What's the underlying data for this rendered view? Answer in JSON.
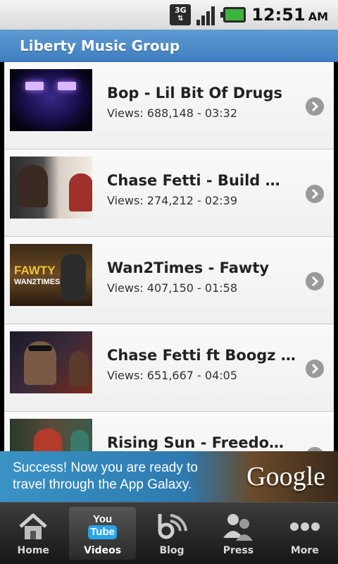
{
  "status_bar": {
    "network_label": "3G",
    "time": "12:51",
    "ampm": "AM"
  },
  "header": {
    "title": "Liberty Music Group"
  },
  "videos": [
    {
      "title": "Bop - Lil Bit Of Drugs",
      "meta": "Views: 688,148 - 03:32"
    },
    {
      "title": "Chase Fetti - Build Wi...",
      "meta": "Views: 274,212 - 02:39"
    },
    {
      "title": "Wan2Times - Fawty",
      "meta": "Views: 407,150 - 01:58",
      "thumb_text_1": "FAWTY",
      "thumb_text_2": "WAN2TIMES"
    },
    {
      "title": "Chase Fetti ft Boogz ...",
      "meta": "Views: 651,667 - 04:05"
    },
    {
      "title": "Rising Sun - Freedom...",
      "meta": ""
    }
  ],
  "ad": {
    "text": "Success! Now you are ready to travel through the App Galaxy.",
    "logo": "Google"
  },
  "tabs": [
    {
      "label": "Home",
      "icon": "home-icon"
    },
    {
      "label": "Videos",
      "icon": "youtube-icon",
      "active": true,
      "icon_text_1": "You",
      "icon_text_2": "Tube"
    },
    {
      "label": "Blog",
      "icon": "blog-icon"
    },
    {
      "label": "Press",
      "icon": "press-icon"
    },
    {
      "label": "More",
      "icon": "more-icon"
    }
  ]
}
